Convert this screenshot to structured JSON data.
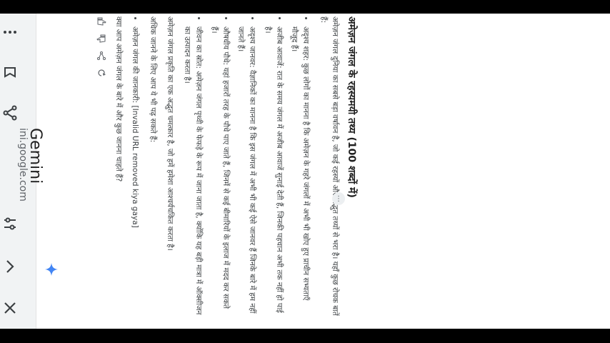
{
  "app": {
    "title": "Gemini",
    "url": "ini.google.com"
  },
  "toolbar": {
    "icons": [
      "close-icon",
      "chevron-right-icon",
      "tune-icon",
      "share-icon",
      "bookmark-icon",
      "more-vert-icon"
    ]
  },
  "response": {
    "heading": "अमेज़न जंगल के रहस्यमयी तथ्य (100 शब्दों में)",
    "intro": "अमेज़न जंगल दुनिया का सबसे बड़ा वर्षावन है, जो कई रहस्यों और अद्भुत तथ्यों से भरा है। यहाँ कुछ रोचक बातें हैं:",
    "bullets": [
      "अदृश्य शहर: कुछ लोगों का मानना है कि अमेज़न के गहरे जंगलों में अभी भी खोए हुए प्राचीन सभ्यताएँ मौजूद हैं।",
      "अजीब आवाजें: रात के समय जंगल में अजीब आवाजें सुनाई देती हैं, जिनकी पहचान अभी तक नहीं हो पाई है।",
      "अदृश्य जानवर: वैज्ञानिकों का मानना है कि इस जंगल में अभी भी कई ऐसे जानवर हैं जिनके बारे में हम नहीं जानते हैं।",
      "औषधीय पौधे: यहां हजारों तरह के पौधे पाए जाते हैं, जिनमें से कई बीमारियों के इलाज में मदद कर सकते हैं।",
      "जीवन का स्रोत: अमेज़न जंगल पृथ्वी के फेफड़े के रूप में जाना जाता है, क्योंकि यह बड़ी मात्रा में ऑक्सीजन का उत्पादन करता है।"
    ],
    "summary": "अमेज़न जंगल प्रकृति का एक अद्भुत चमत्कार है, जो हमें हमेशा आश्चर्यचकित करता है।",
    "more_label": "अधिक जानने के लिए आप ये भी पढ़ सकते हैं:",
    "link_item": "अमेज़न जंगल की जानकारी: [Invalid URL removed kiya gaya]",
    "question": "क्या आप अमेज़न जंगल के बारे में और कुछ जानना चाहते हैं?",
    "more_button": "⋮"
  }
}
